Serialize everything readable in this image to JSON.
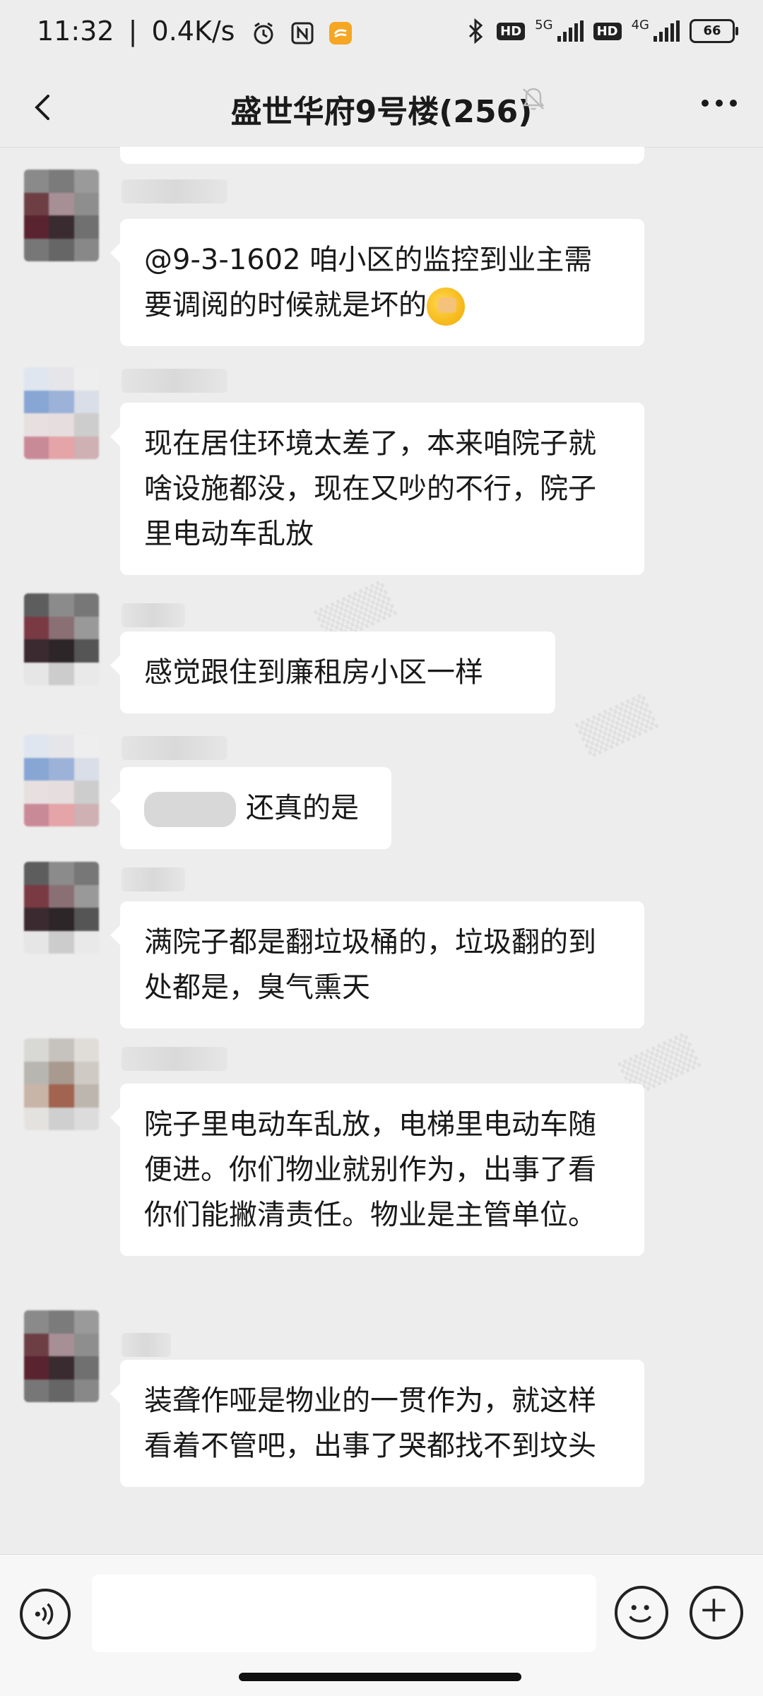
{
  "status_bar": {
    "time": "11:32",
    "speed": "0.4K/s",
    "network_1": "5G",
    "network_2": "4G",
    "hd": "HD",
    "battery": "66"
  },
  "header": {
    "title": "盛世华府9号楼(256)"
  },
  "messages": [
    {
      "text": "@9-3-1602  咱小区的监控到业主需要调阅的时候就是坏的"
    },
    {
      "text": "现在居住环境太差了，本来咱院子就啥设施都没，现在又吵的不行，院子里电动车乱放"
    },
    {
      "text": "感觉跟住到廉租房小区一样"
    },
    {
      "text": "还真的是"
    },
    {
      "text": "满院子都是翻垃圾桶的，垃圾翻的到处都是，臭气熏天"
    },
    {
      "text": "院子里电动车乱放，电梯里电动车随便进。你们物业就别作为，出事了看你们能撇清责任。物业是主管单位。"
    },
    {
      "text": "装聋作哑是物业的一贯作为，就这样看着不管吧，出事了哭都找不到坟头"
    }
  ],
  "input_bar": {
    "placeholder": ""
  },
  "colors": {
    "background": "#ededed",
    "bubble": "#ffffff",
    "text": "#191919"
  }
}
